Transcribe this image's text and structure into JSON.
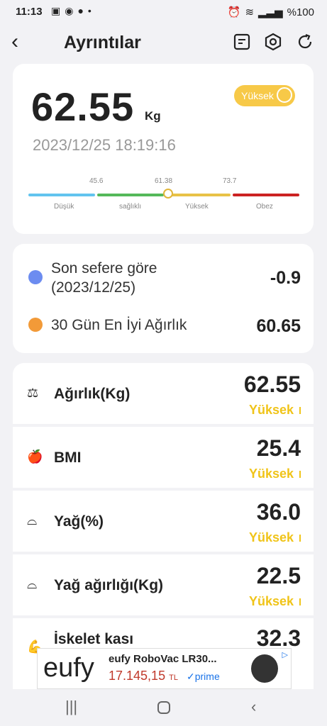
{
  "status_bar": {
    "time": "11:13",
    "battery": "%100"
  },
  "header": {
    "title": "Ayrıntılar",
    "back": "‹"
  },
  "summary": {
    "weight": "62.55",
    "unit": "Kg",
    "status": "Yüksek",
    "datetime": "2023/12/25 18:19:16",
    "ticks": [
      "45.6",
      "61.38",
      "73.7"
    ],
    "ranges": [
      "Düşük",
      "sağlıklı",
      "Yüksek",
      "Obez"
    ],
    "range_colors": [
      "#62c4ef",
      "#55b95a",
      "#e8c247",
      "#cc2222"
    ]
  },
  "comparison": {
    "last": {
      "label_line1": "Son sefere göre",
      "label_line2": "(2023/12/25)",
      "value": "-0.9"
    },
    "best": {
      "label": "30 Gün En İyi Ağırlık",
      "value": "60.65"
    }
  },
  "metrics": [
    {
      "name": "Ağırlık(Kg)",
      "value": "62.55",
      "status": "Yüksek",
      "icon": "scale-icon"
    },
    {
      "name": "BMI",
      "value": "25.4",
      "status": "Yüksek",
      "icon": "apple-icon"
    },
    {
      "name": "Yağ(%)",
      "value": "36.0",
      "status": "Yüksek",
      "icon": "body-fat-icon"
    },
    {
      "name": "Yağ ağırlığı(Kg)",
      "value": "22.5",
      "status": "Yüksek",
      "icon": "body-fat-weight-icon"
    },
    {
      "name": "İskelet kası",
      "value": "32.3",
      "status": "",
      "icon": "muscle-icon"
    }
  ],
  "ad": {
    "brand": "eufy",
    "product": "eufy RoboVac LR30...",
    "price": "17.145,15",
    "currency": "TL",
    "prime": "✓prime"
  },
  "colors": {
    "accent_yellow": "#f0c419",
    "card": "#ffffff",
    "bg": "#f2f2f5"
  }
}
